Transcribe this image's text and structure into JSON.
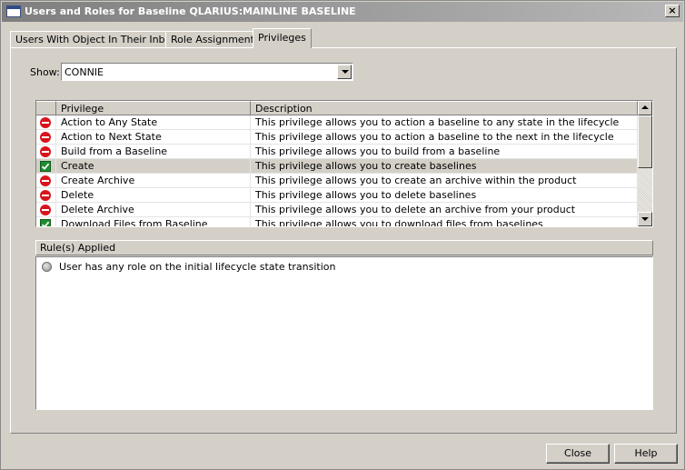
{
  "window": {
    "title": "Users and Roles for Baseline QLARIUS:MAINLINE BASELINE",
    "close_glyph": "×"
  },
  "tabs": [
    {
      "label": "Users With Object In Their Inbox",
      "active": false
    },
    {
      "label": "Role Assignments",
      "active": false
    },
    {
      "label": "Privileges",
      "active": true
    }
  ],
  "show": {
    "label": "Show:",
    "value": "CONNIE"
  },
  "grid": {
    "columns": [
      "Privilege",
      "Description"
    ],
    "rows": [
      {
        "status": "deny",
        "privilege": "Action to Any State",
        "description": "This privilege allows you to action a baseline to any state in the lifecycle"
      },
      {
        "status": "deny",
        "privilege": "Action to Next State",
        "description": "This privilege allows you to action a baseline to the next in the lifecycle"
      },
      {
        "status": "deny",
        "privilege": "Build from a Baseline",
        "description": "This privilege allows you to build from a baseline"
      },
      {
        "status": "allow",
        "privilege": "Create",
        "description": "This privilege allows you to create baselines",
        "selected": true
      },
      {
        "status": "deny",
        "privilege": "Create Archive",
        "description": "This privilege allows you to create an archive within the product"
      },
      {
        "status": "deny",
        "privilege": "Delete",
        "description": "This privilege allows you to delete baselines"
      },
      {
        "status": "deny",
        "privilege": "Delete Archive",
        "description": "This privilege allows you to delete an archive from your product"
      },
      {
        "status": "allow",
        "privilege": "Download Files from Baseline",
        "description": "This privilege allows you to download files from baselines"
      }
    ]
  },
  "rules": {
    "header": "Rule(s) Applied",
    "items": [
      "User has any role on the initial lifecycle state transition"
    ]
  },
  "buttons": {
    "close": "Close",
    "help": "Help"
  },
  "colors": {
    "deny": "#d8141c",
    "allow": "#1e8c30",
    "selected_row": "#d4d0c8"
  }
}
